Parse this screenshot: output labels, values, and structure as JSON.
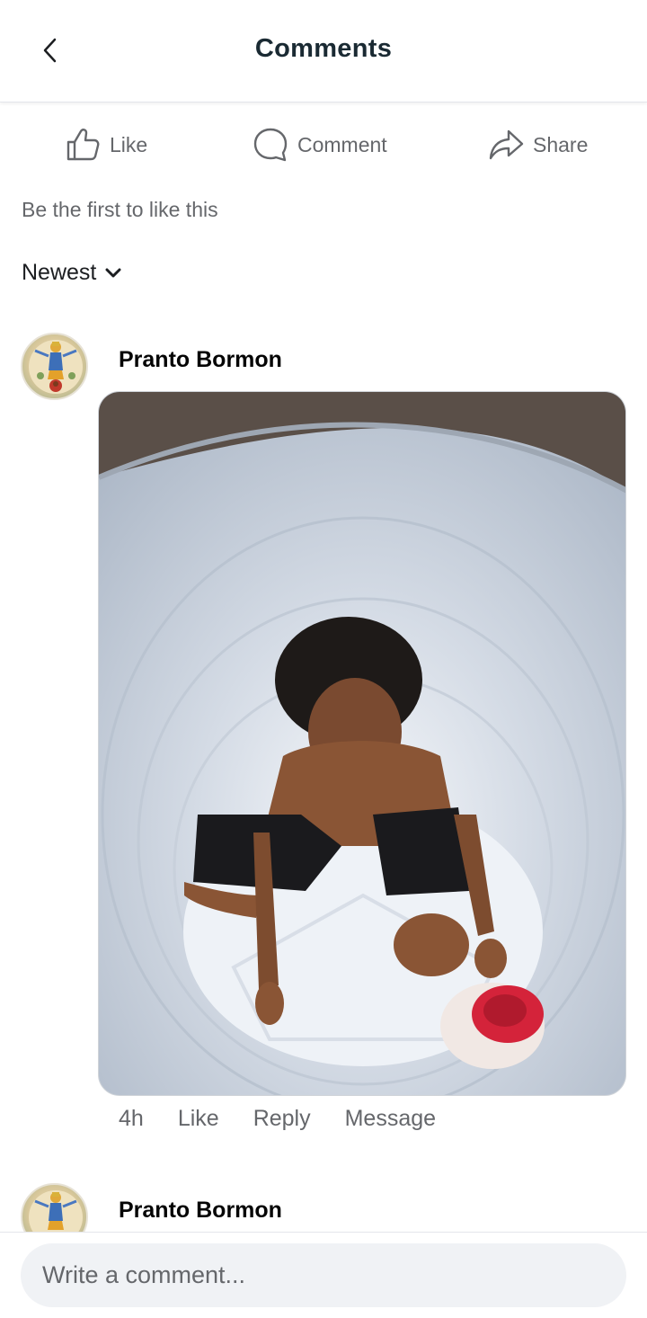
{
  "header": {
    "title": "Comments"
  },
  "actions": {
    "like": "Like",
    "comment": "Comment",
    "share": "Share"
  },
  "reactions_summary": "Be the first to like this",
  "sort": {
    "selected": "Newest"
  },
  "comments": [
    {
      "author": "Pranto Bormon",
      "time": "4h",
      "like_label": "Like",
      "reply_label": "Reply",
      "message_label": "Message"
    },
    {
      "author": "Pranto Bormon"
    }
  ],
  "composer": {
    "placeholder": "Write a comment..."
  },
  "colors": {
    "muted_text": "#65676b",
    "primary_text": "#1c1e21",
    "input_bg": "#f0f2f5"
  }
}
